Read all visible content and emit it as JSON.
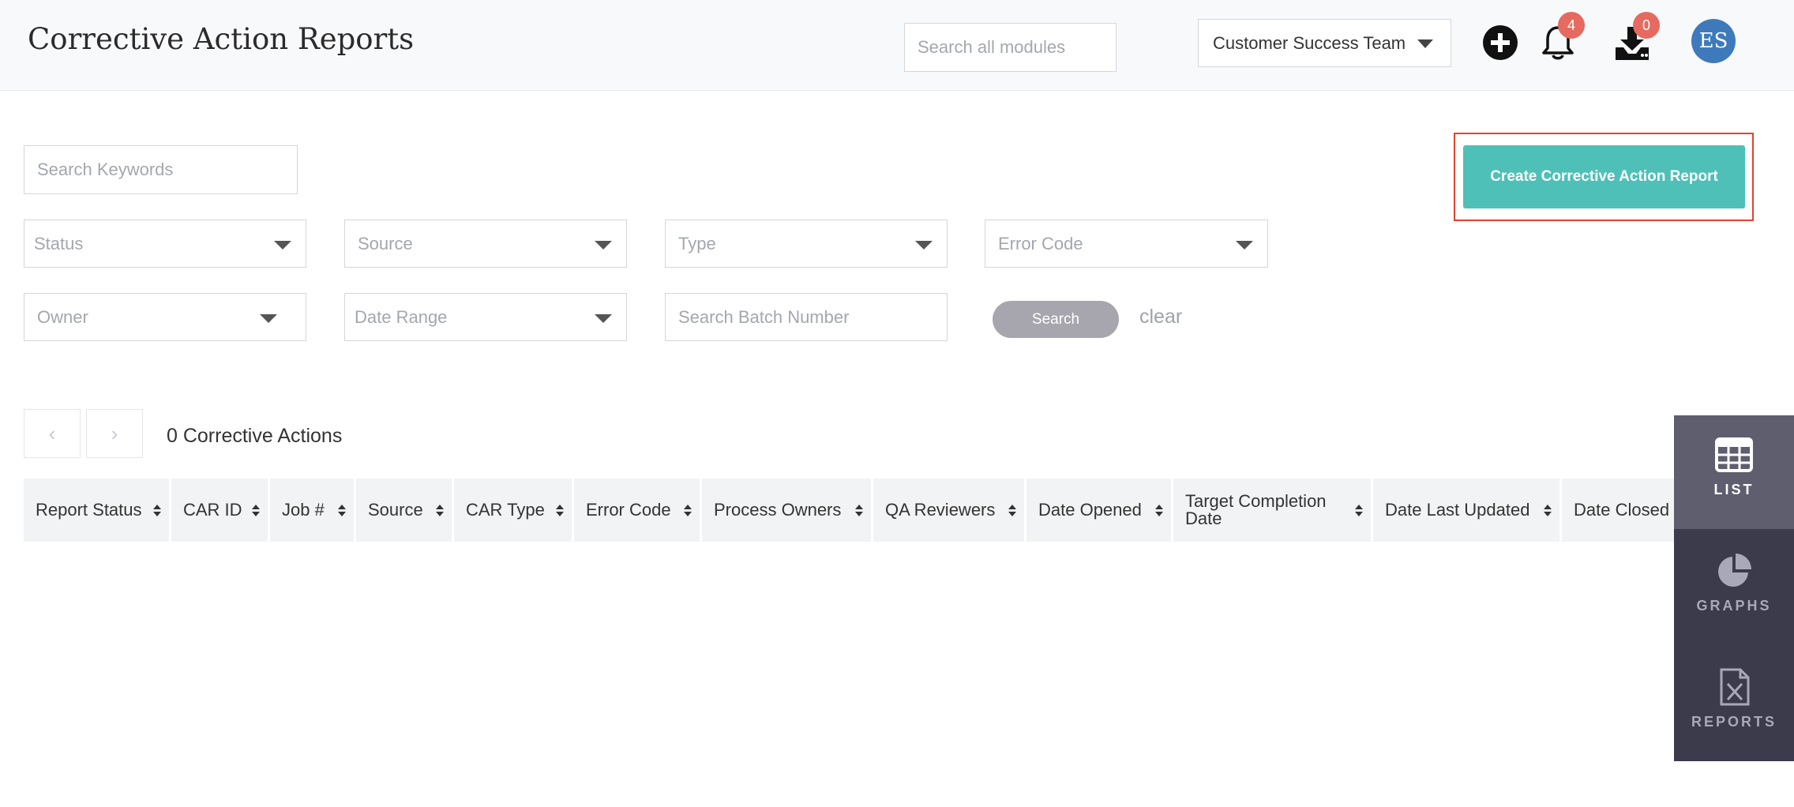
{
  "header": {
    "title": "Corrective Action Reports",
    "search_placeholder": "Search all modules",
    "team": "Customer Success Team",
    "notifications_count": "4",
    "downloads_count": "0",
    "avatar_initials": "ES"
  },
  "filters": {
    "keywords_placeholder": "Search Keywords",
    "status": "Status",
    "source": "Source",
    "type": "Type",
    "error_code": "Error Code",
    "owner": "Owner",
    "date_range": "Date Range",
    "batch_placeholder": "Search Batch Number",
    "search_label": "Search",
    "clear_label": "clear"
  },
  "actions": {
    "create_label": "Create Corrective Action Report"
  },
  "pagination": {
    "prev": "‹",
    "next": "›",
    "count_text": "0 Corrective Actions"
  },
  "table": {
    "columns": [
      "Report Status",
      "CAR ID",
      "Job #",
      "Source",
      "CAR Type",
      "Error Code",
      "Process Owners",
      "QA Reviewers",
      "Date Opened",
      "Target Completion Date",
      "Date Last Updated",
      "Date Closed"
    ]
  },
  "side_panel": {
    "list": "LIST",
    "graphs": "GRAPHS",
    "reports": "REPORTS"
  },
  "colors": {
    "primary": "#4ec0b7",
    "badge": "#e56a5f",
    "avatar": "#3e7abb",
    "side_panel": "#3c3b4c",
    "highlight_frame": "#e0432f"
  }
}
